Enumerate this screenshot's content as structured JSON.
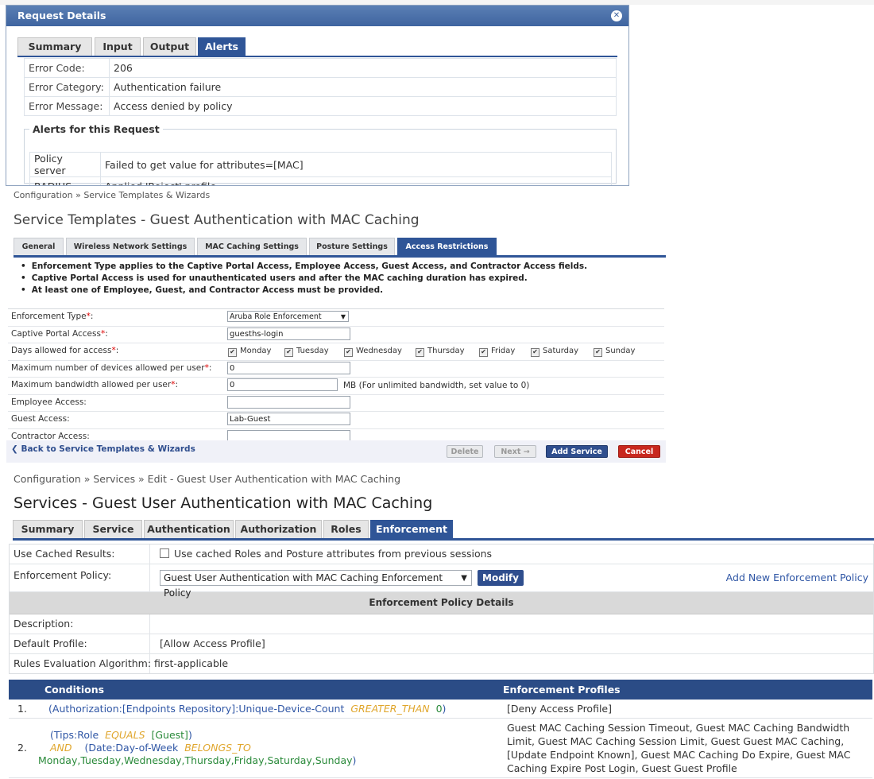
{
  "dialog": {
    "title": "Request Details",
    "tabs": [
      "Summary",
      "Input",
      "Output",
      "Alerts"
    ],
    "active_tab": "Alerts",
    "error_code_label": "Error Code:",
    "error_code": "206",
    "error_category_label": "Error Category:",
    "error_category": "Authentication failure",
    "error_message_label": "Error Message:",
    "error_message": "Access denied by policy",
    "alerts_legend": "Alerts for this Request",
    "alerts": [
      {
        "source": "Policy server",
        "message": "Failed to get value for attributes=[MAC]"
      },
      {
        "source": "RADIUS",
        "message": "Applied 'Reject' profile"
      }
    ]
  },
  "templates": {
    "breadcrumb": "Configuration » Service Templates & Wizards",
    "title": "Service Templates - Guest Authentication with MAC Caching",
    "tabs": [
      "General",
      "Wireless Network Settings",
      "MAC Caching Settings",
      "Posture Settings",
      "Access Restrictions"
    ],
    "active_tab": "Access Restrictions",
    "notes": [
      "Enforcement Type applies to the Captive Portal Access, Employee Access, Guest Access, and Contractor Access fields.",
      "Captive Portal Access is used for unauthenticated users and after the MAC caching duration has expired.",
      "At least one of Employee, Guest, and Contractor Access must be provided."
    ],
    "required_mark": "*",
    "fields": {
      "enforcement_type_label": "Enforcement Type",
      "enforcement_type_value": "Aruba Role Enforcement",
      "captive_portal_label": "Captive Portal Access",
      "captive_portal_value": "guesths-login",
      "days_label": "Days allowed for access",
      "days": [
        "Monday",
        "Tuesday",
        "Wednesday",
        "Thursday",
        "Friday",
        "Saturday",
        "Sunday"
      ],
      "max_devices_label": "Maximum number of devices allowed per user",
      "max_devices_value": "0",
      "max_bandwidth_label": "Maximum bandwidth allowed per user",
      "max_bandwidth_value": "0",
      "bandwidth_unit": "MB (For unlimited bandwidth, set value to 0)",
      "employee_access_label": "Employee Access:",
      "employee_access_value": "",
      "guest_access_label": "Guest Access:",
      "guest_access_value": "Lab-Guest",
      "contractor_access_label": "Contractor Access:",
      "contractor_access_value": ""
    },
    "back_link": "Back to Service Templates & Wizards",
    "buttons": {
      "delete": "Delete",
      "next": "Next →",
      "add": "Add Service",
      "cancel": "Cancel"
    }
  },
  "services": {
    "breadcrumb": "Configuration » Services » Edit - Guest User Authentication with MAC Caching",
    "title": "Services - Guest User Authentication with MAC Caching",
    "tabs": [
      "Summary",
      "Service",
      "Authentication",
      "Authorization",
      "Roles",
      "Enforcement"
    ],
    "active_tab": "Enforcement",
    "use_cached_label": "Use Cached Results:",
    "use_cached_text": "Use cached Roles and Posture attributes from previous sessions",
    "use_cached_checked": false,
    "policy_label": "Enforcement Policy:",
    "policy_value": "Guest User Authentication with MAC Caching Enforcement Policy",
    "modify_label": "Modify",
    "add_policy_link": "Add New Enforcement Policy",
    "details_header": "Enforcement Policy Details",
    "description_label": "Description:",
    "description_value": "",
    "default_profile_label": "Default Profile:",
    "default_profile_value": "[Allow Access Profile]",
    "algorithm_label": "Rules Evaluation Algorithm:",
    "algorithm_value": "first-applicable",
    "conditions_header": "Conditions",
    "profiles_header": "Enforcement Profiles",
    "rules": [
      {
        "num": "1.",
        "cond": {
          "attr": "Authorization:[Endpoints Repository]:Unique-Device-Count",
          "op": "GREATER_THAN",
          "val": "0"
        },
        "profiles": "[Deny Access Profile]"
      },
      {
        "num": "2.",
        "cond1": {
          "attr": "Tips:Role",
          "op": "EQUALS",
          "val": "[Guest]"
        },
        "joiner": "AND",
        "cond2": {
          "attr": "Date:Day-of-Week",
          "op": "BELONGS_TO",
          "val": "Monday,Tuesday,Wednesday,Thursday,Friday,Saturday,Sunday"
        },
        "profiles": "Guest MAC Caching Session Timeout, Guest MAC Caching Bandwidth Limit, Guest MAC Caching Session Limit, Guest Guest MAC Caching, [Update Endpoint Known], Guest MAC Caching Do Expire, Guest MAC Caching Expire Post Login, Guest Guest Profile"
      }
    ]
  }
}
